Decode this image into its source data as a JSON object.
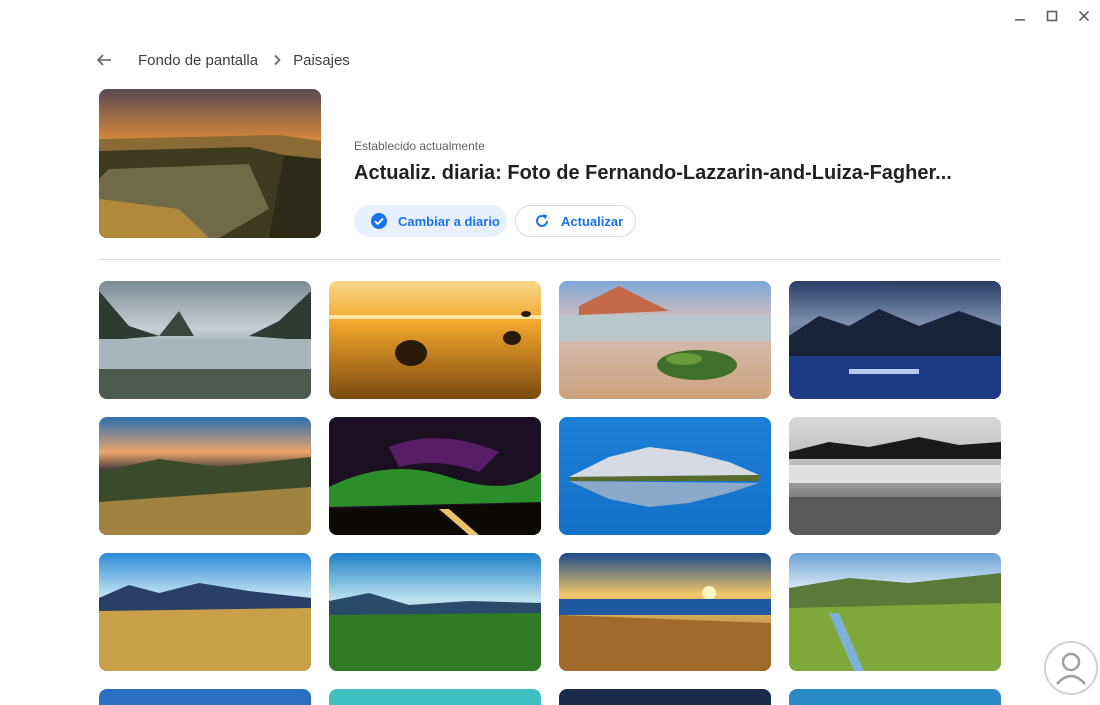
{
  "window": {
    "minimize_icon": "minimize-icon",
    "maximize_icon": "maximize-icon",
    "close_icon": "close-icon"
  },
  "nav": {
    "back_icon": "arrow-back-icon",
    "breadcrumb_root": "Fondo de pantalla",
    "separator_icon": "chevron-right-icon",
    "breadcrumb_current": "Paisajes"
  },
  "current": {
    "image_desc": "sunset-cliff-landscape",
    "status_label": "Establecido actualmente",
    "title": "Actualiz. diaria: Foto de Fernando-Lazzarin-and-Luiza-Fagher...",
    "daily_button_label": "Cambiar a diario",
    "daily_button_icon": "check-circle-icon",
    "refresh_button_label": "Actualizar",
    "refresh_button_icon": "refresh-icon"
  },
  "colors": {
    "accent": "#1a73e8",
    "accent_bg": "#e8f0fe",
    "divider": "#dadce0"
  },
  "wallpapers": [
    {
      "name": "misty-fjord-reflection"
    },
    {
      "name": "golden-beach-boulders"
    },
    {
      "name": "sandy-shore-green-rock"
    },
    {
      "name": "dark-blue-lake-mountains"
    },
    {
      "name": "sunset-valley-road"
    },
    {
      "name": "aurora-night-sky"
    },
    {
      "name": "snowy-mountain-lake"
    },
    {
      "name": "monochrome-lake-shore"
    },
    {
      "name": "golden-grass-mountains"
    },
    {
      "name": "green-field-blue-sky"
    },
    {
      "name": "sunset-lake-hills"
    },
    {
      "name": "green-valley-stream"
    }
  ],
  "watermark_icon": "brand-logo-icon"
}
